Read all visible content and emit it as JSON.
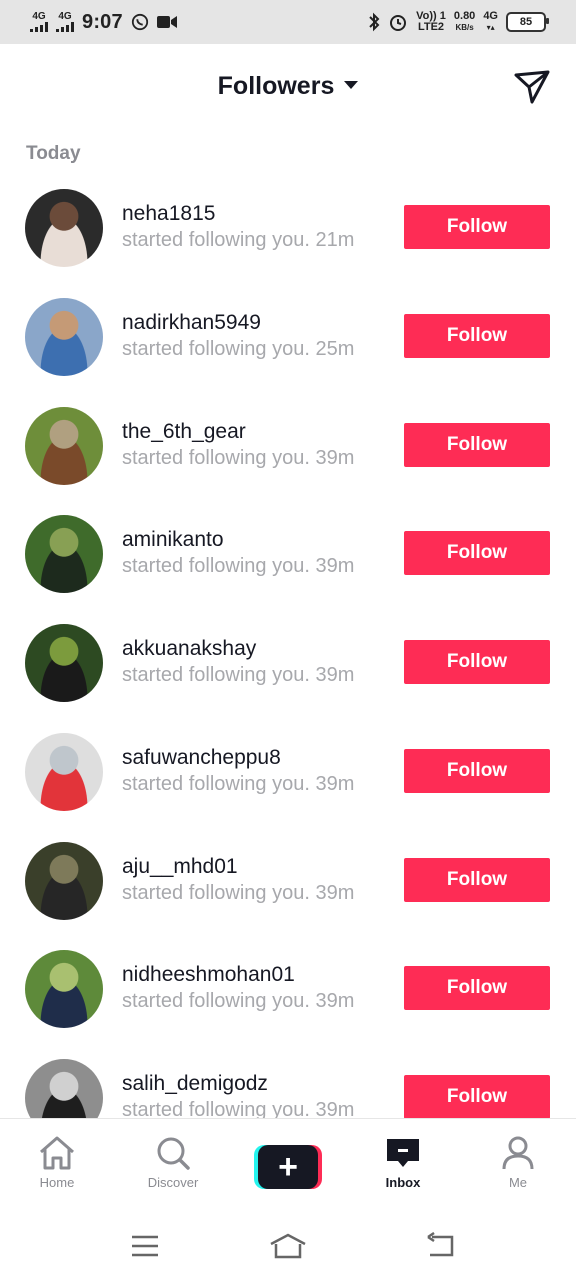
{
  "status": {
    "time": "9:07",
    "net1": "4G",
    "net2": "4G",
    "volte_top": "Vo)) 1",
    "volte_bottom": "LTE2",
    "speed_top": "0.80",
    "speed_bottom": "KB/s",
    "net3": "4G",
    "battery": "85"
  },
  "header": {
    "title": "Followers",
    "send_icon": "send-message-icon"
  },
  "section_label": "Today",
  "followers": [
    {
      "username": "neha1815",
      "message": "started following you.",
      "time": "21m",
      "button": "Follow",
      "avatar_colors": [
        "#2b2b2b",
        "#e8ddd6",
        "#6b4b3a"
      ]
    },
    {
      "username": "nadirkhan5949",
      "message": "started following you.",
      "time": "25m",
      "button": "Follow",
      "avatar_colors": [
        "#8aa6c9",
        "#3d6fb0",
        "#c59a76"
      ]
    },
    {
      "username": "the_6th_gear",
      "message": "started following you.",
      "time": "39m",
      "button": "Follow",
      "avatar_colors": [
        "#6e8e3a",
        "#7a4a2a",
        "#b0a080"
      ]
    },
    {
      "username": "aminikanto",
      "message": "started following you.",
      "time": "39m",
      "button": "Follow",
      "avatar_colors": [
        "#3f6b2b",
        "#1d2a1d",
        "#88a054"
      ]
    },
    {
      "username": "akkuanakshay",
      "message": "started following you.",
      "time": "39m",
      "button": "Follow",
      "avatar_colors": [
        "#2d4a22",
        "#1a1a1a",
        "#7c9b3d"
      ]
    },
    {
      "username": "safuwancheppu8",
      "message": "started following you.",
      "time": "39m",
      "button": "Follow",
      "avatar_colors": [
        "#dedede",
        "#e2343a",
        "#bfc6cc"
      ]
    },
    {
      "username": "aju__mhd01",
      "message": "started following you.",
      "time": "39m",
      "button": "Follow",
      "avatar_colors": [
        "#3a3f2a",
        "#262626",
        "#7e7a5a"
      ]
    },
    {
      "username": "nidheeshmohan01",
      "message": "started following you.",
      "time": "39m",
      "button": "Follow",
      "avatar_colors": [
        "#5e8a3a",
        "#1f2d4a",
        "#a9c070"
      ]
    },
    {
      "username": "salih_demigodz",
      "message": "started following you.",
      "time": "39m",
      "button": "Follow",
      "avatar_colors": [
        "#8e8e8e",
        "#1e1e1e",
        "#d0d0d0"
      ]
    }
  ],
  "bottom_nav": [
    {
      "label": "Home",
      "icon": "home-icon"
    },
    {
      "label": "Discover",
      "icon": "search-icon"
    },
    {
      "label": "",
      "icon": "create-plus-icon"
    },
    {
      "label": "Inbox",
      "icon": "inbox-icon"
    },
    {
      "label": "Me",
      "icon": "profile-icon"
    }
  ],
  "colors": {
    "accent": "#fe2c55",
    "cyan": "#25f4ee",
    "text_primary": "#161823",
    "text_secondary": "#a7a8ac"
  }
}
